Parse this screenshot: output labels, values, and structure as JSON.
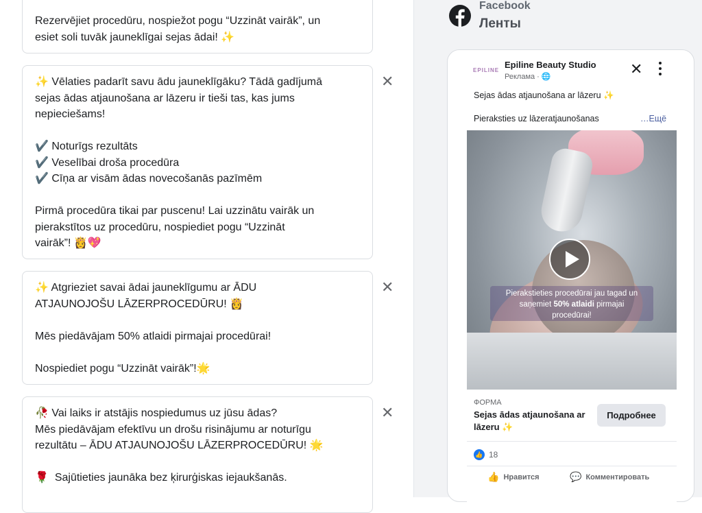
{
  "cards": [
    {
      "text": "Rezervējiet procedūru, nospiežot pogu “Uzzināt vairāk”, un\nesiet soli tuvāk jauneklīgai sejas ādai! ✨"
    },
    {
      "text": "✨ Vēlaties padarīt savu ādu jauneklīgāku? Tādā gadījumā\nsejas ādas atjaunošana ar lāzeru ir tieši tas, kas jums\nnepieciešams!\n\n✔️ Noturīgs rezultāts\n✔️ Veselībai droša procedūra\n✔️ Cīņa ar visām ādas novecošanās pazīmēm\n\nPirmā procedūra tikai par puscenu! Lai uzzinātu vairāk un\npierakstītos uz procedūru, nospiediet pogu “Uzzināt\nvairāk”! 👸💖"
    },
    {
      "text": "✨ Atgrieziet savai ādai jauneklīgumu ar ĀDU\nATJAUNOJOŠU LĀZERPROCEDŪRU! 👸\n\nMēs piedāvājam 50% atlaidi pirmajai procedūrai!\n\nNospiediet pogu “Uzzināt vairāk”!🌟"
    },
    {
      "text": "🥀 Vai laiks ir atstājis nospiedumus uz jūsu ādas?\nMēs piedāvājam efektīvu un drošu risinājumu ar noturīgu\nrezultātu – ĀDU ATJAUNOJOŠU LĀZERPROCEDŪRU! 🌟\n\n🌹  Sajūtieties jaunāka bez ķirurģiskas iejaukšanās."
    }
  ],
  "close_symbol": "✕",
  "preview": {
    "platform": "Facebook",
    "placement": "Ленты",
    "page_avatar_text": "EPILINE",
    "page_name": "Epiline Beauty Studio",
    "sponsored": "Реклама · 🌐",
    "primary_text": "Sejas ādas atjaunošana ar lāzeru ✨",
    "primary_text_line2": "Pieraksties uz lāzeratjaunošanas",
    "see_more": "…Ещё",
    "video_overlay_line1": "Pierakstieties procedūrai jau tagad un",
    "video_overlay_line2a": "saņemiet ",
    "video_overlay_bold": "50% atlaidi",
    "video_overlay_line2b": " pirmajai",
    "video_overlay_line3": "procedūrai!",
    "form_label": "ФОРМА",
    "headline": "Sejas ādas atjaunošana ar lāzeru ✨",
    "cta": "Подробнее",
    "like_count": "18",
    "like_action": "Нравится",
    "comment_action": "Комментировать"
  },
  "colors": {
    "facebook_blue": "#1877f2",
    "border": "#dadde1"
  }
}
